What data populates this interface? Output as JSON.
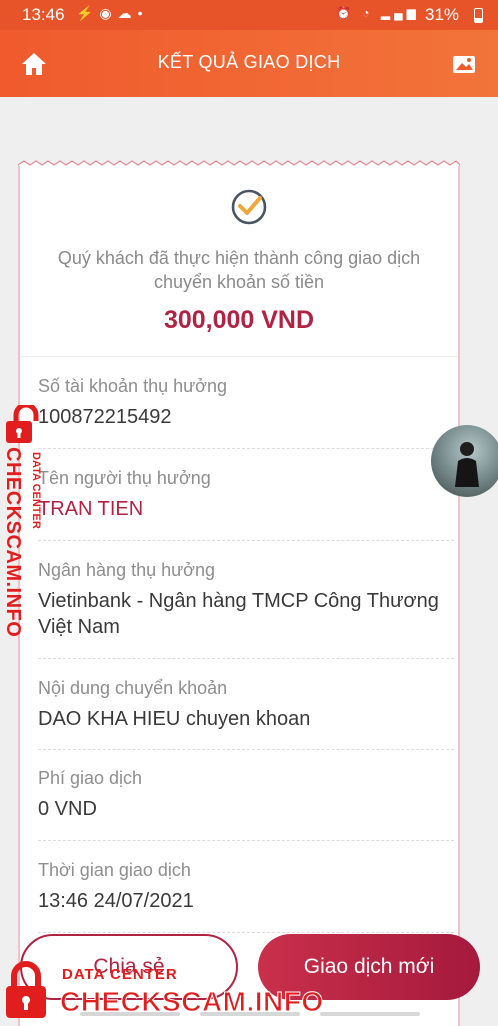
{
  "status_bar": {
    "time": "13:46",
    "battery": "31%"
  },
  "header": {
    "title": "KẾT QUẢ GIAO DỊCH"
  },
  "receipt": {
    "message": "Quý khách đã thực hiện thành công giao dịch chuyển khoản số tiền",
    "amount": "300,000 VND",
    "fields": [
      {
        "label": "Số tài khoản thụ hưởng",
        "value": "100872215492"
      },
      {
        "label": "Tên người thụ hưởng",
        "value": "TRAN TIEN"
      },
      {
        "label": "Ngân hàng thụ hưởng",
        "value": "Vietinbank - Ngân hàng TMCP Công Thương Việt Nam"
      },
      {
        "label": "Nội dung chuyển khoản",
        "value": "DAO KHA HIEU chuyen khoan"
      },
      {
        "label": "Phí giao dịch",
        "value": "0 VND"
      },
      {
        "label": "Thời gian giao dịch",
        "value": "13:46 24/07/2021"
      }
    ]
  },
  "actions": {
    "share": "Chia sẻ",
    "new_transaction": "Giao dịch mới"
  },
  "watermark": {
    "brand": "CHECKSCAM.INFO",
    "subtitle": "DATA CENTER"
  },
  "colors": {
    "header": "#f05a2d",
    "accent": "#b22343",
    "watermark": "#e21d1d"
  }
}
